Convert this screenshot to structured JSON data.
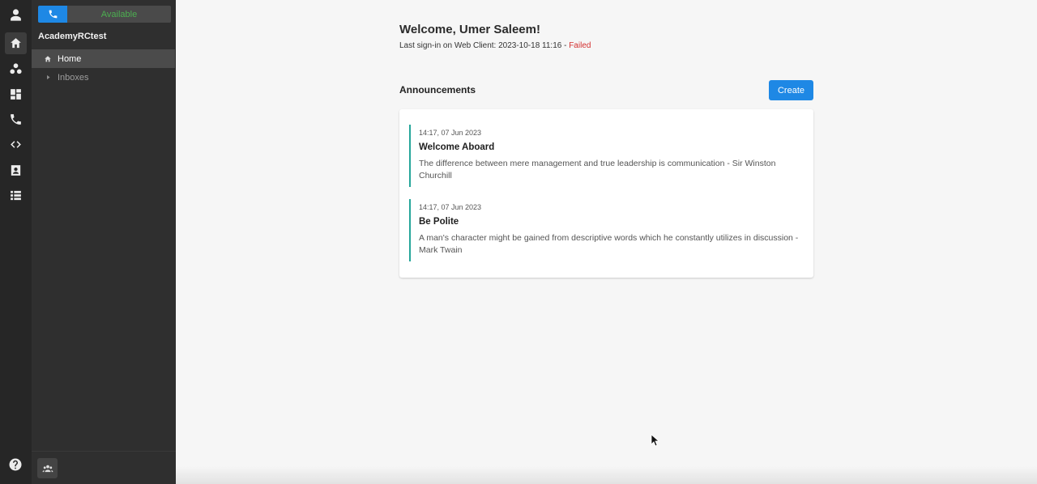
{
  "status_bar": {
    "status_label": "Available"
  },
  "nav": {
    "org_name": "AcademyRCtest",
    "items": [
      {
        "label": "Home"
      },
      {
        "label": "Inboxes"
      }
    ]
  },
  "main": {
    "welcome": "Welcome, Umer Saleem!",
    "last_signin_prefix": "Last sign-in on Web Client: 2023-10-18 11:16 - ",
    "last_signin_status": "Failed",
    "announcements_title": "Announcements",
    "create_label": "Create",
    "announcements": [
      {
        "time": "14:17, 07 Jun 2023",
        "title": "Welcome Aboard",
        "body": "The difference between mere management and true leadership is communication - Sir Winston Churchill"
      },
      {
        "time": "14:17, 07 Jun 2023",
        "title": "Be Polite",
        "body": "A man's character might be gained from descriptive words which he constantly utilizes in discussion - Mark Twain"
      }
    ]
  },
  "colors": {
    "accent": "#1e88e5",
    "available": "#4caf50",
    "failed": "#d32f2f",
    "announcement_bar": "#26a69a"
  },
  "icons": [
    "user-icon",
    "home-icon",
    "teams-icon",
    "dashboard-icon",
    "phone-icon",
    "code-icon",
    "contacts-icon",
    "list-icon",
    "help-icon",
    "team-icon",
    "chevron-right-icon"
  ]
}
